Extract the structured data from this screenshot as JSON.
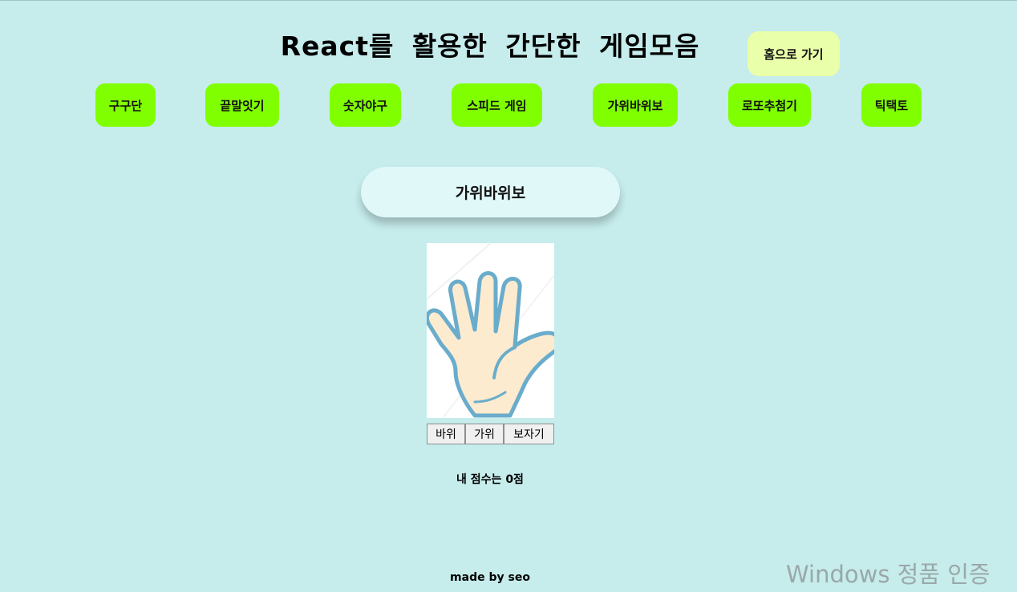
{
  "header": {
    "title": "React를 활용한 간단한 게임모음",
    "home_label": "홈으로 가기"
  },
  "nav": {
    "items": [
      {
        "label": "구구단"
      },
      {
        "label": "끝말잇기"
      },
      {
        "label": "숫자야구"
      },
      {
        "label": "스피드 게임"
      },
      {
        "label": "가위바위보"
      },
      {
        "label": "로또추첨기"
      },
      {
        "label": "틱택토"
      }
    ]
  },
  "game": {
    "title": "가위바위보",
    "current_hand_icon": "open-palm-hand",
    "buttons": {
      "rock": "바위",
      "scissors": "가위",
      "paper": "보자기"
    },
    "score_text": "내 점수는 0점"
  },
  "footer": {
    "credit": "made by seo"
  },
  "overlay": {
    "windows_watermark": "Windows 정품 인증"
  },
  "colors": {
    "background": "#c6ecec",
    "nav_button": "#80ff00",
    "home_button": "#eaffa9",
    "game_card": "#e0f8f8",
    "hand_stroke": "#6aaccb",
    "hand_fill": "#fdebd0"
  }
}
